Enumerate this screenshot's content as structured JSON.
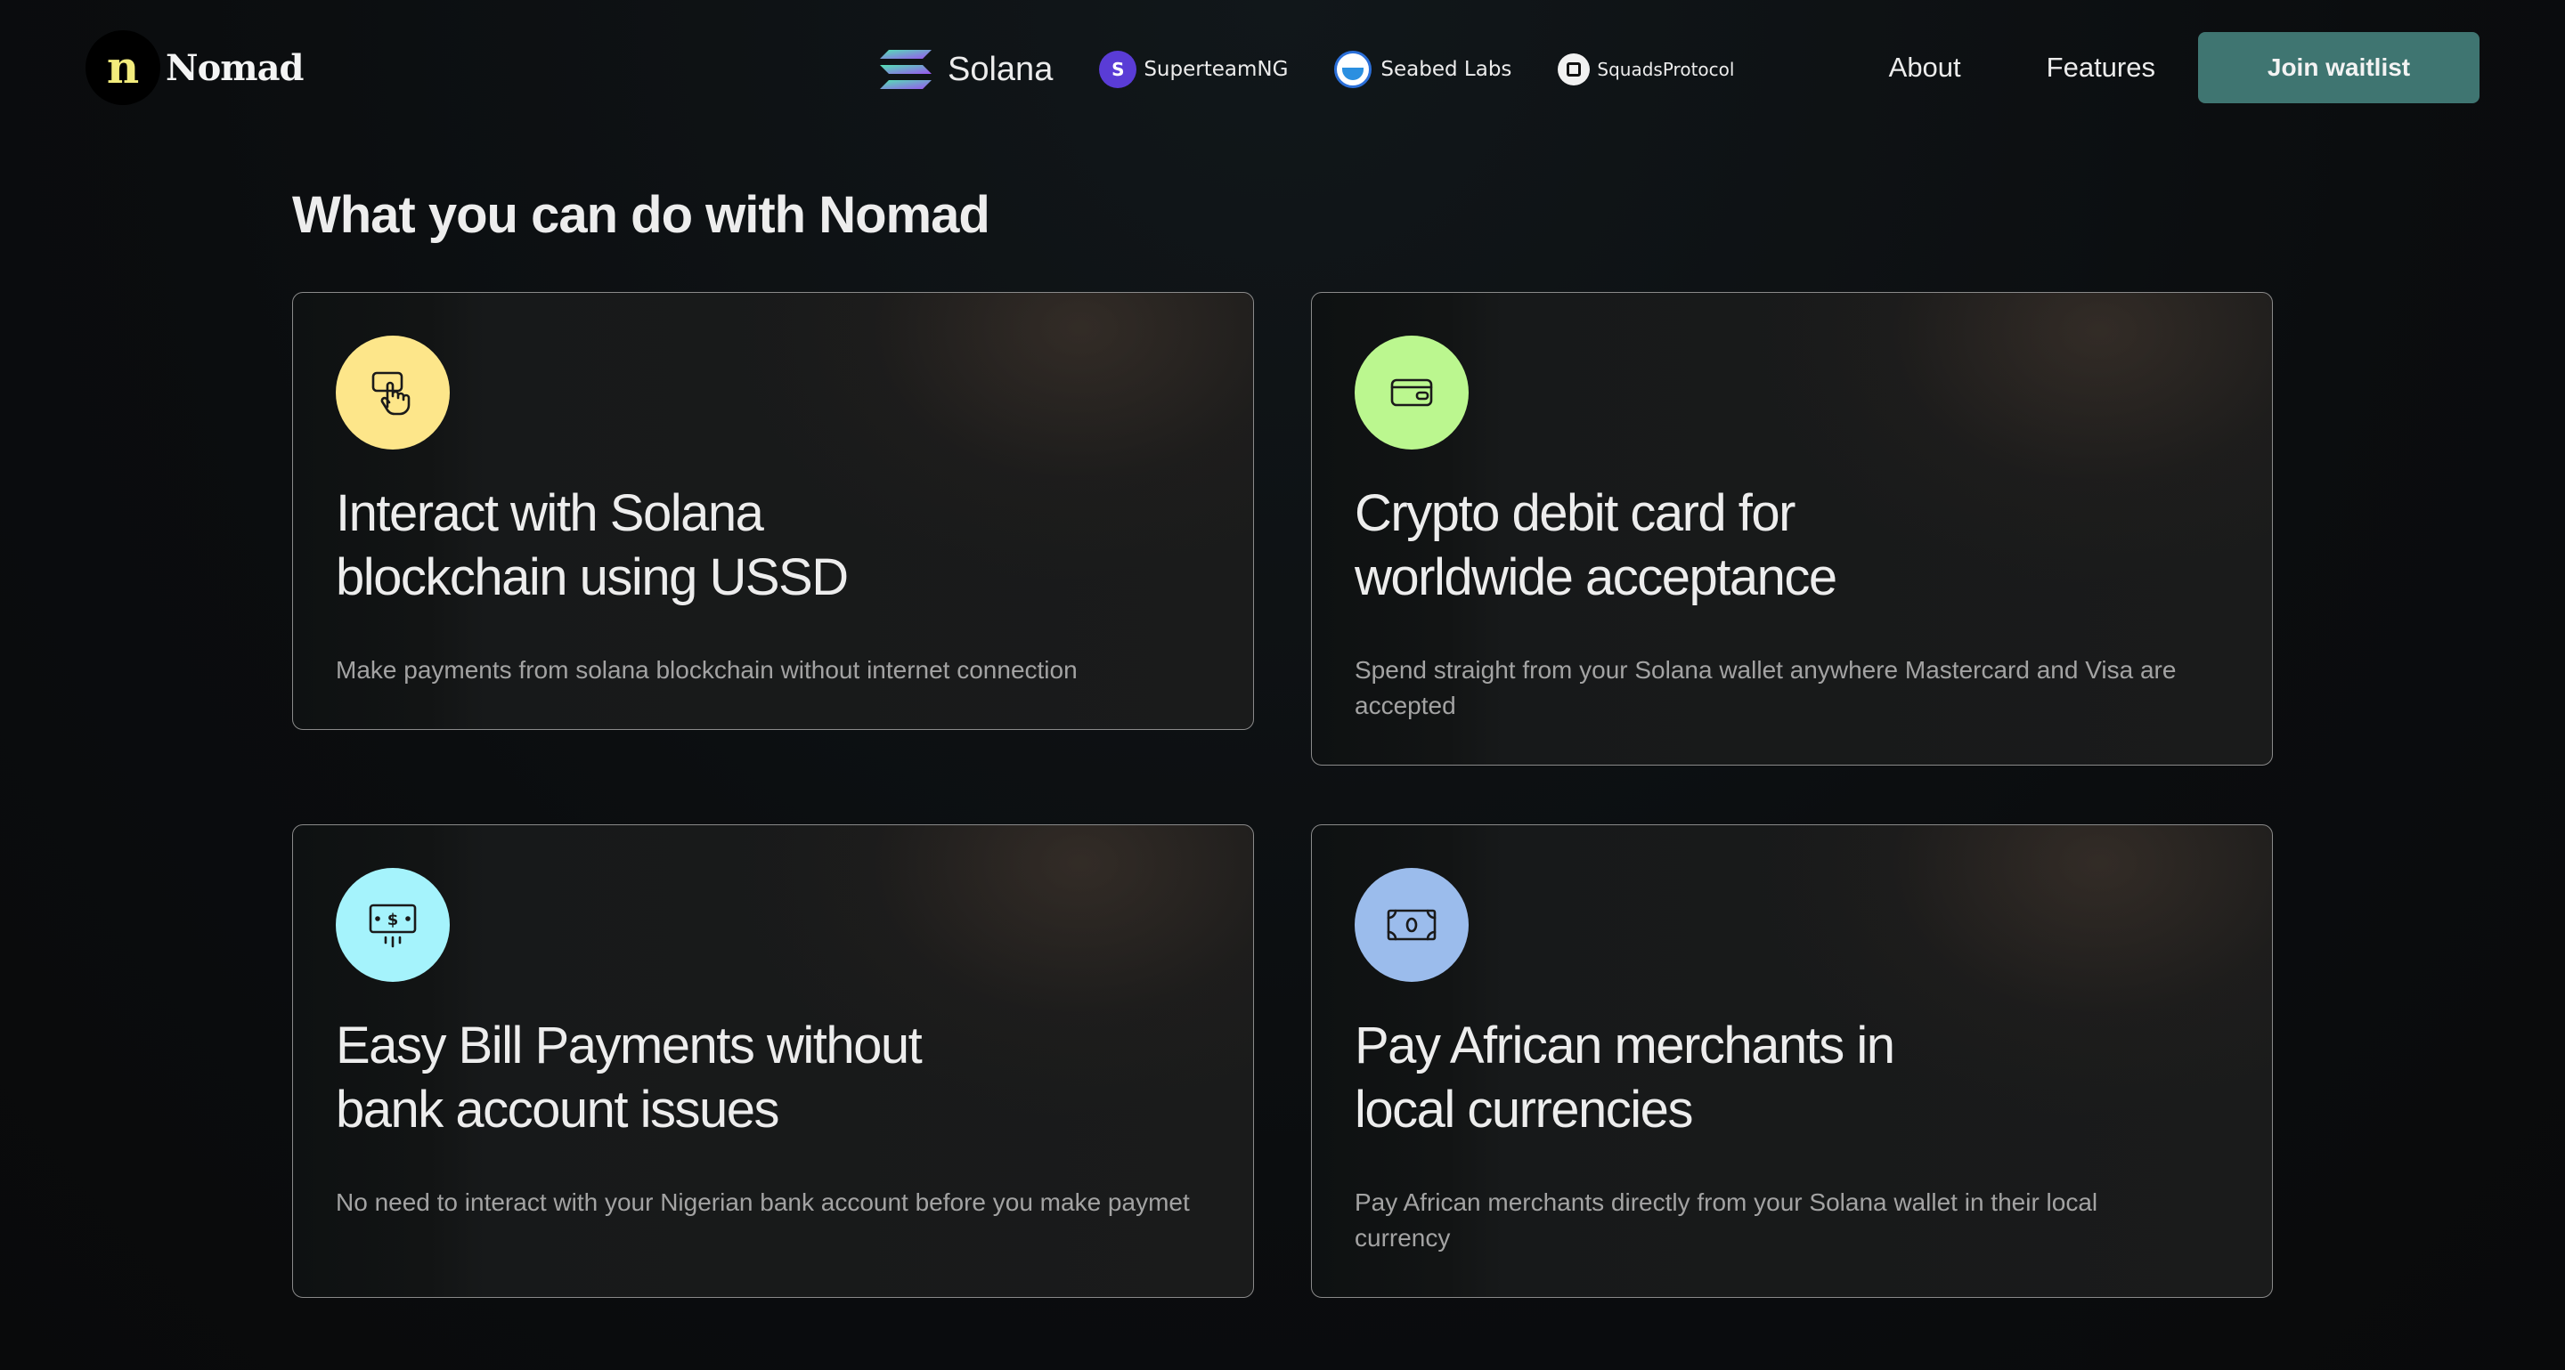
{
  "brand": {
    "logo_letter": "n",
    "name": "Nomad"
  },
  "partners": [
    {
      "name": "Solana",
      "icon": "solana-logo-icon"
    },
    {
      "name": "SuperteamNG",
      "icon": "superteam-logo-icon"
    },
    {
      "name": "Seabed Labs",
      "icon": "seabed-labs-logo-icon"
    },
    {
      "name": "SquadsProtocol",
      "icon": "squads-logo-icon"
    }
  ],
  "nav": {
    "about": "About",
    "features": "Features",
    "cta": "Join waitlist"
  },
  "section": {
    "title": "What you can do with Nomad"
  },
  "features": [
    {
      "title_line1": "Interact with Solana",
      "title_line2": "blockchain using USSD",
      "description": "Make payments from solana blockchain without internet connection",
      "icon": "tap-finger-icon",
      "icon_color": "#fde68a"
    },
    {
      "title_line1": "Crypto debit card for",
      "title_line2": "worldwide acceptance",
      "description": "Spend straight from your Solana wallet anywhere Mastercard and Visa are accepted",
      "icon": "wallet-card-icon",
      "icon_color": "#bbf78f"
    },
    {
      "title_line1": "Easy Bill Payments without",
      "title_line2": "bank account issues",
      "description": "No need to interact with your Nigerian bank account before you make paymet",
      "icon": "bill-dollar-icon",
      "icon_color": "#a5f3fc"
    },
    {
      "title_line1": "Pay African merchants in",
      "title_line2": "local currencies",
      "description": "Pay African merchants directly from your Solana wallet in their local currency",
      "icon": "banknote-icon",
      "icon_color": "#9bbcec"
    }
  ],
  "colors": {
    "accent": "#3f7571",
    "background": "#0c0f11",
    "card_border": "#8a8a8a"
  }
}
